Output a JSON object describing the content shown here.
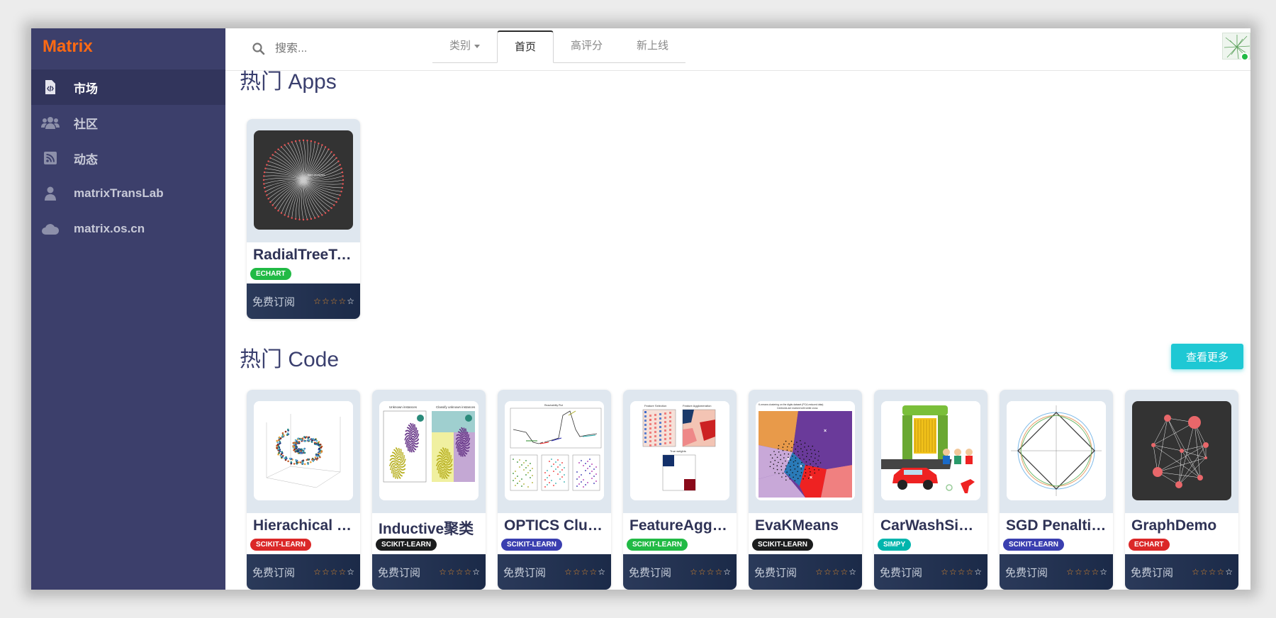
{
  "brand": "Matrix",
  "sidebar": {
    "items": [
      {
        "label": "市场",
        "icon": "code-file-icon",
        "active": true
      },
      {
        "label": "社区",
        "icon": "users-icon",
        "active": false
      },
      {
        "label": "动态",
        "icon": "rss-icon",
        "active": false
      },
      {
        "label": "matrixTransLab",
        "icon": "user-icon",
        "active": false
      },
      {
        "label": "matrix.os.cn",
        "icon": "cloud-icon",
        "active": false
      }
    ]
  },
  "topbar": {
    "search_placeholder": "搜索...",
    "tabs": [
      {
        "label": "类别",
        "dropdown": true,
        "active": false
      },
      {
        "label": "首页",
        "dropdown": false,
        "active": true
      },
      {
        "label": "高评分",
        "dropdown": false,
        "active": false
      },
      {
        "label": "新上线",
        "dropdown": false,
        "active": false
      }
    ],
    "avatar_status": "online"
  },
  "sections": {
    "apps": {
      "title": "热门 Apps",
      "cards": [
        {
          "name": "RadialTreeTool",
          "tag": "ECHART",
          "tag_color": "#21ba45",
          "price": "免费订阅",
          "thumb": "radial-tree",
          "rating": 4
        }
      ]
    },
    "code": {
      "title": "热门 Code",
      "more_label": "查看更多",
      "cards": [
        {
          "name": "Hierachical Cl...",
          "tag": "SCIKIT-LEARN",
          "tag_color": "#db2828",
          "price": "免费订阅",
          "thumb": "swiss-roll",
          "rating": 4
        },
        {
          "name": "Inductive聚类",
          "tag": "SCIKIT-LEARN",
          "tag_color": "#1b1c1d",
          "price": "免费订阅",
          "thumb": "inductive",
          "rating": 4
        },
        {
          "name": "OPTICS Clust...",
          "tag": "SCIKIT-LEARN",
          "tag_color": "#3a3fb0",
          "price": "免费订阅",
          "thumb": "optics",
          "rating": 4
        },
        {
          "name": "FeatureAgglo...",
          "tag": "SCIKIT-LEARN",
          "tag_color": "#21ba45",
          "price": "免费订阅",
          "thumb": "feature-agglo",
          "rating": 4
        },
        {
          "name": "EvaKMeans",
          "tag": "SCIKIT-LEARN",
          "tag_color": "#1b1c1d",
          "price": "免费订阅",
          "thumb": "kmeans",
          "rating": 4
        },
        {
          "name": "CarWashSimpy",
          "tag": "SIMPY",
          "tag_color": "#00b5ad",
          "price": "免费订阅",
          "thumb": "carwash",
          "rating": 4
        },
        {
          "name": "SGD Penalties",
          "tag": "SCIKIT-LEARN",
          "tag_color": "#3a3fb0",
          "price": "免费订阅",
          "thumb": "sgd",
          "rating": 4
        },
        {
          "name": "GraphDemo",
          "tag": "ECHART",
          "tag_color": "#db2828",
          "price": "免费订阅",
          "thumb": "graph",
          "rating": 4
        }
      ]
    }
  },
  "thumb_text": {
    "kmeans_title": "K-means clustering on the digits dataset (PCA-reduced data)",
    "kmeans_sub": "Centroids are marked with white cross",
    "inductive_left": "Unknown instances",
    "inductive_right": "Classify unknown instances",
    "optics_top": "Reachability Plot",
    "feature_sel": "Feature Selection",
    "feature_agg": "Feature Agglomeration",
    "feature_true": "True weights",
    "radial_label": "flare.analytics"
  },
  "colors": {
    "sidebar_bg": "#3c3f6b",
    "brand": "#ff6a13",
    "title": "#3a3f6e",
    "more_button": "#1ec8d4",
    "card_thumb_bg": "#dfe7ef",
    "card_foot": "#2b3a5a"
  }
}
